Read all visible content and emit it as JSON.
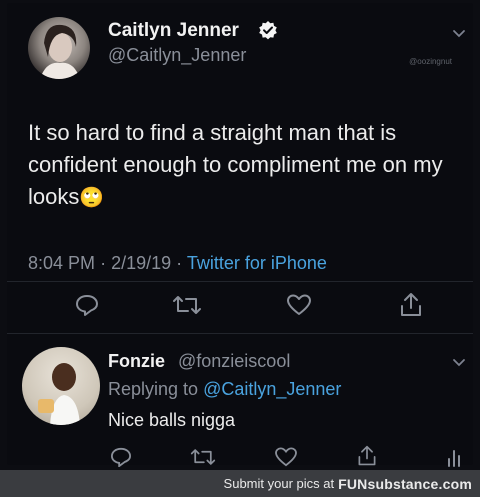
{
  "tweet": {
    "author_name": "Caitlyn Jenner",
    "author_handle": "@Caitlyn_Jenner",
    "watermark": "@oozingnut",
    "text": "It so hard to find a straight man that is confident enough to compliment me on my looks",
    "emoji": "🙄",
    "time": "8:04 PM",
    "date": "2/19/19",
    "source": "Twitter for iPhone",
    "separator": "·"
  },
  "reply": {
    "author_name": "Fonzie",
    "author_handle": "@fonzieiscool",
    "replying_prefix": "Replying to",
    "replying_to": "@Caitlyn_Jenner",
    "text": "Nice balls nigga"
  },
  "footer": {
    "text": "Submit your pics at",
    "brand": "FUNsubstance.com"
  },
  "icons": [
    "verified-icon",
    "chevron-down-icon",
    "reply-icon",
    "retweet-icon",
    "like-icon",
    "share-icon",
    "analytics-icon"
  ],
  "colors": {
    "background": "#0a0b10",
    "link": "#4aa3df",
    "verified": "#ffffff",
    "footer": "#3a3c40"
  }
}
